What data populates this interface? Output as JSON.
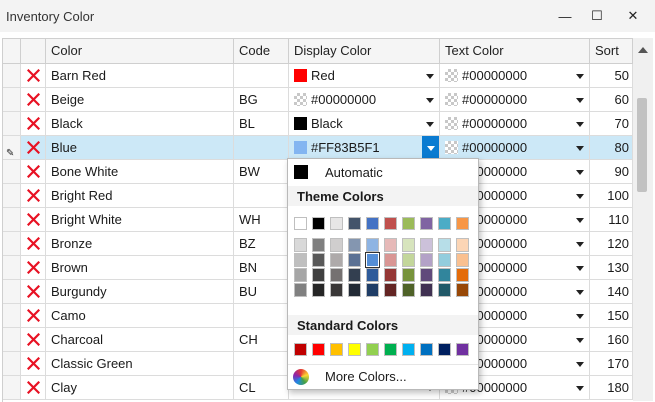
{
  "window": {
    "title": "Inventory Color",
    "min_glyph": "—",
    "max_glyph": "☐",
    "close_glyph": "✕"
  },
  "columns": {
    "color": "Color",
    "code": "Code",
    "display_color": "Display Color",
    "text_color": "Text Color",
    "sort": "Sort"
  },
  "rows": [
    {
      "name": "Barn Red",
      "code": "",
      "display": {
        "label": "Red",
        "swatch": "#ff0000"
      },
      "text": {
        "label": "#00000000",
        "swatch": "transparent"
      },
      "sort": "50"
    },
    {
      "name": "Beige",
      "code": "BG",
      "display": {
        "label": "#00000000",
        "swatch": "transparent"
      },
      "text": {
        "label": "#00000000",
        "swatch": "transparent"
      },
      "sort": "60"
    },
    {
      "name": "Black",
      "code": "BL",
      "display": {
        "label": "Black",
        "swatch": "#000000"
      },
      "text": {
        "label": "#00000000",
        "swatch": "transparent"
      },
      "sort": "70"
    },
    {
      "name": "Blue",
      "code": "",
      "display": {
        "label": "#FF83B5F1",
        "swatch": "#83b5f1"
      },
      "text": {
        "label": "#00000000",
        "swatch": "transparent"
      },
      "sort": "80",
      "selected": true
    },
    {
      "name": "Bone White",
      "code": "BW",
      "display": {
        "label": "",
        "swatch": ""
      },
      "text": {
        "label": "#00000000",
        "swatch": "transparent"
      },
      "sort": "90"
    },
    {
      "name": "Bright Red",
      "code": "",
      "display": {
        "label": "",
        "swatch": ""
      },
      "text": {
        "label": "#00000000",
        "swatch": "transparent"
      },
      "sort": "100"
    },
    {
      "name": "Bright White",
      "code": "WH",
      "display": {
        "label": "",
        "swatch": ""
      },
      "text": {
        "label": "#00000000",
        "swatch": "transparent"
      },
      "sort": "110"
    },
    {
      "name": "Bronze",
      "code": "BZ",
      "display": {
        "label": "",
        "swatch": ""
      },
      "text": {
        "label": "#00000000",
        "swatch": "transparent"
      },
      "sort": "120"
    },
    {
      "name": "Brown",
      "code": "BN",
      "display": {
        "label": "",
        "swatch": ""
      },
      "text": {
        "label": "#00000000",
        "swatch": "transparent"
      },
      "sort": "130"
    },
    {
      "name": "Burgundy",
      "code": "BU",
      "display": {
        "label": "",
        "swatch": ""
      },
      "text": {
        "label": "#00000000",
        "swatch": "transparent"
      },
      "sort": "140"
    },
    {
      "name": "Camo",
      "code": "",
      "display": {
        "label": "",
        "swatch": ""
      },
      "text": {
        "label": "#00000000",
        "swatch": "transparent"
      },
      "sort": "150"
    },
    {
      "name": "Charcoal",
      "code": "CH",
      "display": {
        "label": "",
        "swatch": ""
      },
      "text": {
        "label": "#00000000",
        "swatch": "transparent"
      },
      "sort": "160"
    },
    {
      "name": "Classic Green",
      "code": "",
      "display": {
        "label": "",
        "swatch": ""
      },
      "text": {
        "label": "#00000000",
        "swatch": "transparent"
      },
      "sort": "170"
    },
    {
      "name": "Clay",
      "code": "CL",
      "display": {
        "label": "",
        "swatch": ""
      },
      "text": {
        "label": "#00000000",
        "swatch": "transparent"
      },
      "sort": "180"
    }
  ],
  "picker": {
    "automatic_label": "Automatic",
    "automatic_color": "#000000",
    "theme_title": "Theme Colors",
    "standard_title": "Standard Colors",
    "more_label": "More Colors...",
    "selected_theme_cell": "4,1",
    "theme_top": [
      "#ffffff",
      "#000000",
      "#e7e6e6",
      "#44546a",
      "#4472c4",
      "#c0504d",
      "#9bbb59",
      "#8064a2",
      "#4bacc6",
      "#f79646"
    ],
    "theme_shades": [
      [
        "#d9d9d9",
        "#bfbfbf",
        "#a6a6a6",
        "#808080"
      ],
      [
        "#7f7f7f",
        "#595959",
        "#404040",
        "#262626"
      ],
      [
        "#d0cece",
        "#aeaaaa",
        "#757171",
        "#3a3838"
      ],
      [
        "#8496b0",
        "#5b7194",
        "#333f50",
        "#222a35"
      ],
      [
        "#8eb4e3",
        "#558ed5",
        "#2e5b9a",
        "#1f3d66"
      ],
      [
        "#e6b9b8",
        "#d99694",
        "#953735",
        "#632523"
      ],
      [
        "#d7e4bd",
        "#c3d69b",
        "#77933c",
        "#4f6228"
      ],
      [
        "#ccc1da",
        "#b3a2c7",
        "#604a7b",
        "#403152"
      ],
      [
        "#b7dee8",
        "#93cddd",
        "#31859c",
        "#215968"
      ],
      [
        "#fcd5b5",
        "#fac090",
        "#e46c0a",
        "#984807"
      ]
    ],
    "standard": [
      "#c00000",
      "#ff0000",
      "#ffc000",
      "#ffff00",
      "#92d050",
      "#00b050",
      "#00b0f0",
      "#0070c0",
      "#002060",
      "#7030a0"
    ]
  }
}
